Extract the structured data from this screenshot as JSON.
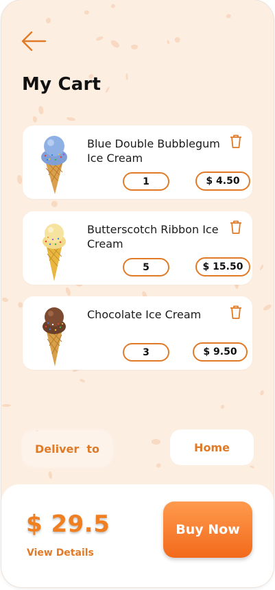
{
  "header": {
    "back_icon": "arrow-left-icon",
    "title": "My Cart"
  },
  "cart": {
    "items": [
      {
        "name": "Blue Double Bubblegum Ice Cream",
        "quantity": "1",
        "price": "$ 4.50",
        "image": "blue-bubblegum-cone",
        "delete_icon": "trash-icon"
      },
      {
        "name": "Butterscotch Ribbon Ice Cream",
        "quantity": "5",
        "price": "$ 15.50",
        "image": "butterscotch-cone",
        "delete_icon": "trash-icon"
      },
      {
        "name": "Chocolate Ice Cream",
        "quantity": "3",
        "price": "$ 9.50",
        "image": "chocolate-cone",
        "delete_icon": "trash-icon"
      }
    ]
  },
  "delivery": {
    "label": "Deliver  to",
    "location": "Home"
  },
  "checkout": {
    "total": "$ 29.5",
    "details_link": "View Details",
    "buy_label": "Buy Now"
  },
  "colors": {
    "accent": "#e07a26",
    "background": "#fdeee2",
    "buy_button": "#f57a28"
  }
}
